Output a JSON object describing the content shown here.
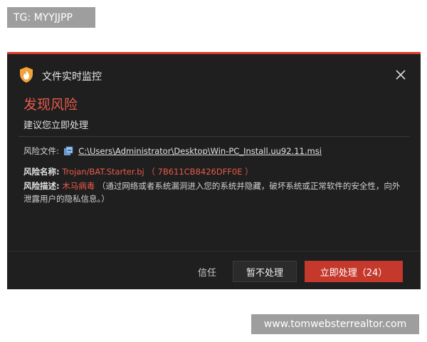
{
  "watermarks": {
    "top": "TG: MYYJJPP",
    "bottom": "www.tomwebsterrealtor.com"
  },
  "dialog": {
    "app_title": "文件实时监控",
    "app_icon": "shield-fire-icon",
    "close_icon": "close-icon",
    "heading": "发现风险",
    "subheading": "建议您立即处理",
    "file_label": "风险文件:",
    "file_icon": "installer-file-icon",
    "file_path": "C:\\Users\\Administrator\\Desktop\\Win-PC_Install.uu92.11.msi",
    "name_label": "风险名称:",
    "risk_name": "Trojan/BAT.Starter.bj",
    "risk_hash": "（ 7B611CB8426DFF0E ）",
    "desc_label": "风险描述:",
    "desc_type": "木马病毒",
    "desc_text": "（通过网络或者系统漏洞进入您的系统并隐藏，破坏系统或正常软件的安全性，向外泄露用户的隐私信息。）",
    "trust_label": "信任",
    "ignore_label": "暂不处理",
    "handle_label": "立即处理（24）"
  },
  "colors": {
    "accent": "#d93a2b",
    "danger_text": "#e85a4a",
    "background": "#1f1f1f"
  }
}
